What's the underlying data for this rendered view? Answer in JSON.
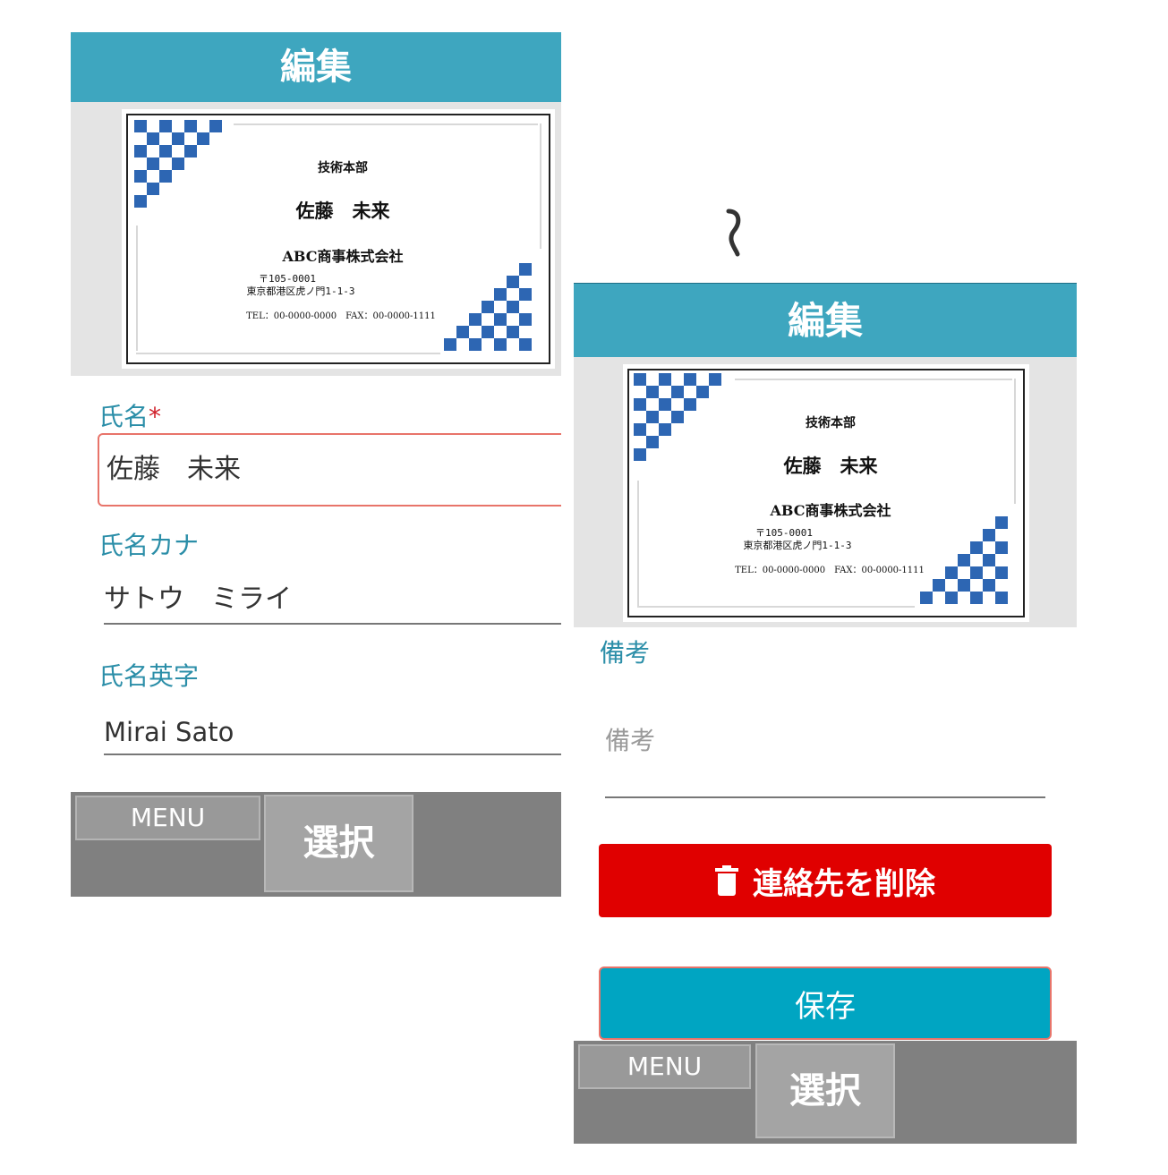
{
  "screens": [
    {
      "header_title": "編集",
      "card": {
        "department": "技術本部",
        "person_name": "佐藤　未来",
        "company": "ABC商事株式会社",
        "postal_code": "〒105-0001",
        "address": "東京都港区虎ノ門1-1-3",
        "contact": "TEL：00-0000-0000　FAX：00-0000-1111"
      },
      "fields": [
        {
          "label": "氏名",
          "required_mark": "*",
          "value": "佐藤　未来"
        },
        {
          "label": "氏名カナ",
          "value": "サトウ　ミライ"
        },
        {
          "label": "氏名英字",
          "value": "Mirai Sato"
        }
      ],
      "menu_label": "MENU",
      "select_label": "選択"
    },
    {
      "header_title": "編集",
      "card": {
        "department": "技術本部",
        "person_name": "佐藤　未来",
        "company": "ABC商事株式会社",
        "postal_code": "〒105-0001",
        "address": "東京都港区虎ノ門1-1-3",
        "contact": "TEL：00-0000-0000　FAX：00-0000-1111"
      },
      "notes": {
        "label": "備考",
        "placeholder": "備考"
      },
      "delete_label": "連絡先を削除",
      "save_label": "保存",
      "menu_label": "MENU",
      "select_label": "選択"
    }
  ],
  "colors": {
    "header": "#3ea6bf",
    "label": "#2b8ea8",
    "delete": "#e00000",
    "save": "#00a5c2",
    "checker": "#2d66b3"
  },
  "icons": {
    "transition": "squiggle-arrow-icon",
    "delete": "trash-icon"
  }
}
